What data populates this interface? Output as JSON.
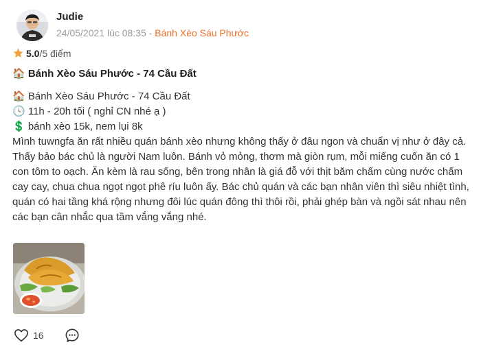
{
  "review": {
    "author": "Judie",
    "date_prefix": "24/05/2021 lúc 08:35 - ",
    "venue": "Bánh Xèo Sáu Phước",
    "rating": {
      "score": "5.0",
      "scale": "/5 điểm",
      "icon": "star-icon",
      "color": "#f0a33a"
    },
    "title": "🏠 Bánh Xèo Sáu Phước - 74 Cầu Đất",
    "body_lines": [
      "🏠 Bánh Xèo Sáu Phước - 74 Cầu Đất",
      "🕓 11h - 20h tối ( nghỉ CN nhé ạ )",
      "💲 bánh xèo 15k, nem lụi 8k",
      "Mình tuwngfa ăn rất nhiều quán bánh xèo nhưng không thấy ở đâu ngon và chuẩn vị như ở đây cả.",
      "Thấy bảo bác chủ là người Nam luôn. Bánh vỏ mỏng, thơm mà giòn rụm, mỗi miếng cuốn ăn có 1",
      "con tôm to oạch. Ăn kèm là rau sống, bên trong nhân là giá đỗ với thịt băm chấm cùng nước chấm",
      "cay cay, chua chua ngọt ngọt phê ríu luôn ấy. Bác chủ quán và các bạn nhân viên thì siêu nhiệt tình,",
      "quán có hai tầng khá rộng nhưng đôi lúc quán đông thì thôi rồi, phải ghép bàn và ngồi sát nhau nên",
      "các bạn cân nhắc qua tầm vắng vắng nhé."
    ],
    "photo": {
      "subject": "banh-xeo-plate"
    },
    "likes": "16",
    "icons": {
      "like": "heart-icon",
      "comment": "comment-icon"
    },
    "accent_color": "#e8702a"
  }
}
